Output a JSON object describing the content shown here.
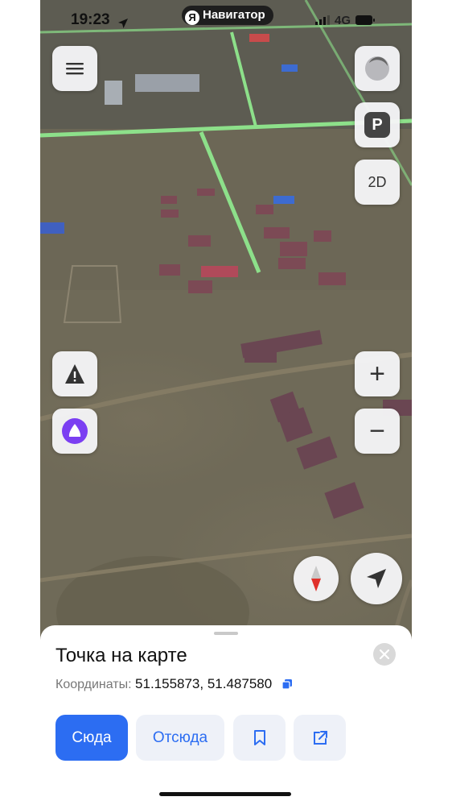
{
  "status_bar": {
    "time": "19:23",
    "network": "4G",
    "app_pill": {
      "logo_letter": "Я",
      "label": "Навигатор"
    }
  },
  "map_controls": {
    "menu_icon": "hamburger-icon",
    "voice_icon": "circle-icon",
    "parking_label": "P",
    "view_mode_label": "2D",
    "zoom_in_label": "+",
    "zoom_out_label": "−",
    "alert_icon": "warning-icon",
    "assistant_icon": "alice-icon",
    "compass_icon": "compass-icon",
    "locate_icon": "navigation-arrow-icon"
  },
  "place_card": {
    "title": "Точка на карте",
    "coordinates_label": "Координаты:",
    "coordinates_value": "51.155873, 51.487580",
    "copy_icon": "copy-icon",
    "close_icon": "close-icon",
    "actions": {
      "route_to": "Сюда",
      "route_from": "Отсюда",
      "bookmark_icon": "bookmark-icon",
      "share_icon": "share-icon"
    }
  },
  "colors": {
    "primary": "#2c6df2",
    "secondary_bg": "#eef1f8",
    "alice_purple": "#7b3ff2",
    "road_green": "#8de08a"
  }
}
